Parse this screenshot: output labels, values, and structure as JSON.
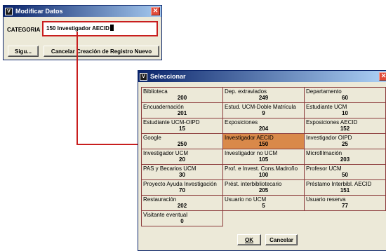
{
  "modificar": {
    "title": "Modificar Datos",
    "close_glyph": "✕",
    "app_icon": "V",
    "categoria_label": "CATEGORIA",
    "categoria_value": "150  Investigador AECID",
    "sigu_label": "Sigu...",
    "cancel_label": "Cancelar Creación de Registro Nuevo"
  },
  "seleccionar": {
    "title": "Seleccionar",
    "close_glyph": "✕",
    "app_icon": "V",
    "ok_label": "OK",
    "cancel_label": "Cancelar",
    "selected_code": "150",
    "items": [
      {
        "name": "Biblioteca",
        "code": "200"
      },
      {
        "name": "Dep. extraviados",
        "code": "249"
      },
      {
        "name": "Departamento",
        "code": "60"
      },
      {
        "name": "Encuadernación",
        "code": "201"
      },
      {
        "name": "Estud. UCM-Doble Matrícula",
        "code": "9"
      },
      {
        "name": "Estudiante UCM",
        "code": "10"
      },
      {
        "name": "Estudiante UCM-OIPD",
        "code": "15"
      },
      {
        "name": "Exposiciones",
        "code": "204"
      },
      {
        "name": "Exposiciones AECID",
        "code": "152"
      },
      {
        "name": "Google",
        "code": "250"
      },
      {
        "name": "Investigador AECID",
        "code": "150"
      },
      {
        "name": "Investigador OIPD",
        "code": "25"
      },
      {
        "name": "Investigador UCM",
        "code": "20"
      },
      {
        "name": "Investigador no UCM",
        "code": "105"
      },
      {
        "name": "Microfilmación",
        "code": "203"
      },
      {
        "name": "PAS y Becarios UCM",
        "code": "30"
      },
      {
        "name": "Prof. e Invest. Cons.Madroño",
        "code": "100"
      },
      {
        "name": "Profesor UCM",
        "code": "50"
      },
      {
        "name": "Proyecto Ayuda Investigación",
        "code": "70"
      },
      {
        "name": "Prést. interbibliotecario",
        "code": "205"
      },
      {
        "name": "Préstamo Interbibl. AECID",
        "code": "151"
      },
      {
        "name": "Restauración",
        "code": "202"
      },
      {
        "name": "Usuario no UCM",
        "code": "5"
      },
      {
        "name": "Usuario reserva",
        "code": "77"
      },
      {
        "name": "Visitante eventual",
        "code": "0"
      }
    ]
  },
  "colors": {
    "highlight": "#c81e1e",
    "selected_cell": "#d9894a",
    "title_bar": "#0a246a"
  }
}
